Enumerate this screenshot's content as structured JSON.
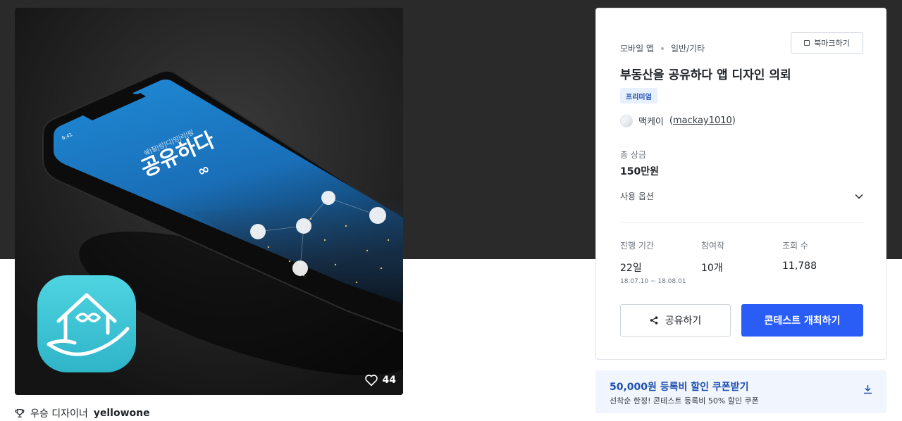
{
  "hero": {
    "app_name": "공유하다",
    "app_tagline": "쉐|질|링|디|밍|리|링",
    "phone_time": "9:41",
    "like_count": "44"
  },
  "winner": {
    "prefix": "우승 디자이너",
    "name": "yellowone"
  },
  "card": {
    "category_main": "모바일 앱",
    "category_sub": "일반/기타",
    "bookmark_label": "북마크하기",
    "title": "부동산을 공유하다 앱 디자인 의뢰",
    "badge": "프리미엄",
    "host_name": "맥케이",
    "host_id_open": "(",
    "host_id": "mackay1010",
    "host_id_close": ")",
    "prize_label": "총 상금",
    "prize_value": "150만원",
    "usage_label": "사용 옵션",
    "stats": [
      {
        "label": "진행 기간",
        "value": "22일",
        "sub": "18.07.10 ~ 18.08.01"
      },
      {
        "label": "참여작",
        "value": "10개",
        "sub": ""
      },
      {
        "label": "조회 수",
        "value": "11,788",
        "sub": ""
      }
    ],
    "share_label": "공유하기",
    "host_button_label": "콘테스트 개최하기"
  },
  "coupon": {
    "title": "50,000원 등록비 할인 쿠폰받기",
    "subtitle": "선착순 한정! 콘테스트 등록비 50% 할인 쿠폰"
  },
  "colors": {
    "primary": "#2a5cf6",
    "coupon_bg": "#f1f5fd",
    "badge_text": "#1c4fb0",
    "dark_band": "#2a2a2a",
    "app_icon": "#3fc6d6"
  }
}
